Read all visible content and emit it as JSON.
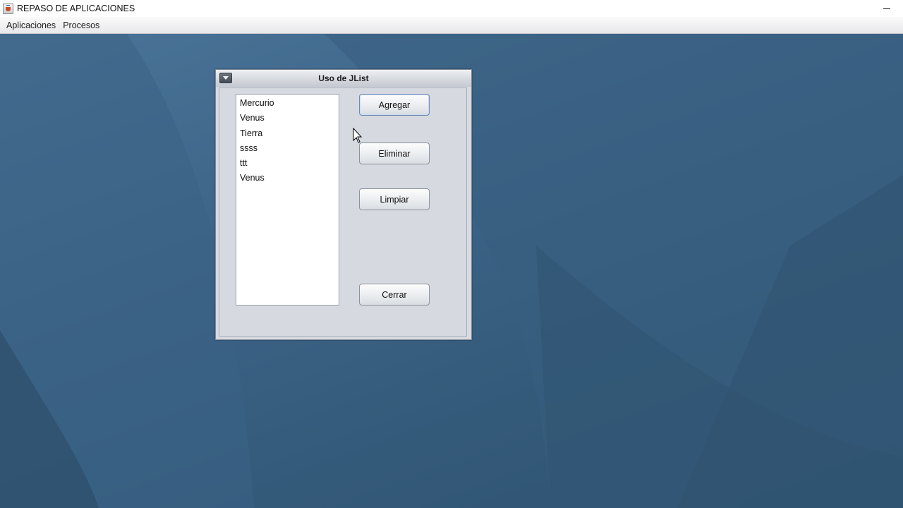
{
  "window": {
    "title": "REPASO DE APLICACIONES",
    "icon": "java-cup-icon",
    "controls": [
      "minimize"
    ]
  },
  "menubar": {
    "items": [
      {
        "label": "Aplicaciones"
      },
      {
        "label": "Procesos"
      }
    ]
  },
  "internal_frame": {
    "title": "Uso de JList",
    "list": {
      "items": [
        "Mercurio",
        "Venus",
        "Tierra",
        "ssss",
        "ttt",
        "Venus"
      ]
    },
    "buttons": {
      "add": "Agregar",
      "remove": "Eliminar",
      "clear": "Limpiar",
      "close": "Cerrar"
    }
  },
  "colors": {
    "desktop": "#3c6080",
    "frame_body": "#d7dae2",
    "menubar": "#f0f0f2"
  }
}
